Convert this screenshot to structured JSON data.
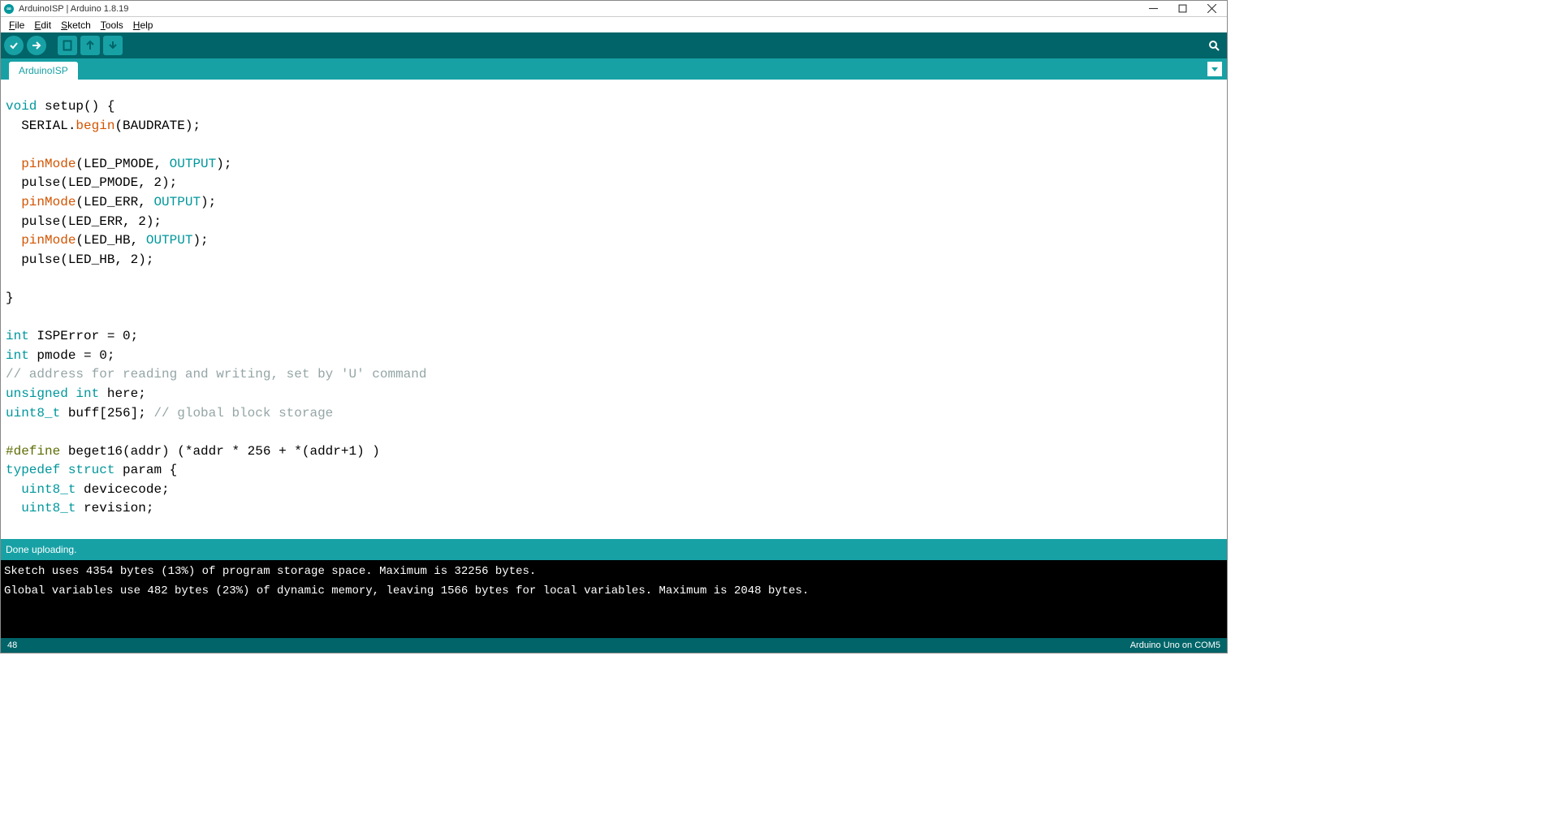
{
  "title": "ArduinoISP | Arduino 1.8.19",
  "menu": {
    "file": "File",
    "edit": "Edit",
    "sketch": "Sketch",
    "tools": "Tools",
    "help": "Help"
  },
  "tab": "ArduinoISP",
  "status": "Done uploading.",
  "console": {
    "l1": "Sketch uses 4354 bytes (13%) of program storage space. Maximum is 32256 bytes.",
    "l2": "Global variables use 482 bytes (23%) of dynamic memory, leaving 1566 bytes for local variables. Maximum is 2048 bytes."
  },
  "bottom": {
    "line": "48",
    "board": "Arduino Uno on COM5"
  },
  "code": {
    "l1a": "void",
    "l1b": " setup() {",
    "l2a": "  SERIAL.",
    "l2b": "begin",
    "l2c": "(BAUDRATE);",
    "l3": "",
    "l4a": "  ",
    "l4b": "pinMode",
    "l4c": "(LED_PMODE, ",
    "l4d": "OUTPUT",
    "l4e": ");",
    "l5": "  pulse(LED_PMODE, 2);",
    "l6a": "  ",
    "l6b": "pinMode",
    "l6c": "(LED_ERR, ",
    "l6d": "OUTPUT",
    "l6e": ");",
    "l7": "  pulse(LED_ERR, 2);",
    "l8a": "  ",
    "l8b": "pinMode",
    "l8c": "(LED_HB, ",
    "l8d": "OUTPUT",
    "l8e": ");",
    "l9": "  pulse(LED_HB, 2);",
    "l10": "",
    "l11": "}",
    "l12": "",
    "l13a": "int",
    "l13b": " ISPError = 0;",
    "l14a": "int",
    "l14b": " pmode = 0;",
    "l15": "// address for reading and writing, set by 'U' command",
    "l16a": "unsigned",
    "l16b": " ",
    "l16c": "int",
    "l16d": " here;",
    "l17a": "uint8_t",
    "l17b": " buff[256]; ",
    "l17c": "// global block storage",
    "l18": "",
    "l19a": "#define",
    "l19b": " beget16(addr) (*addr * 256 + *(addr+1) )",
    "l20a": "typedef",
    "l20b": " ",
    "l20c": "struct",
    "l20d": " param {",
    "l21a": "  ",
    "l21b": "uint8_t",
    "l21c": " devicecode;",
    "l22a": "  ",
    "l22b": "uint8_t",
    "l22c": " revision;"
  }
}
